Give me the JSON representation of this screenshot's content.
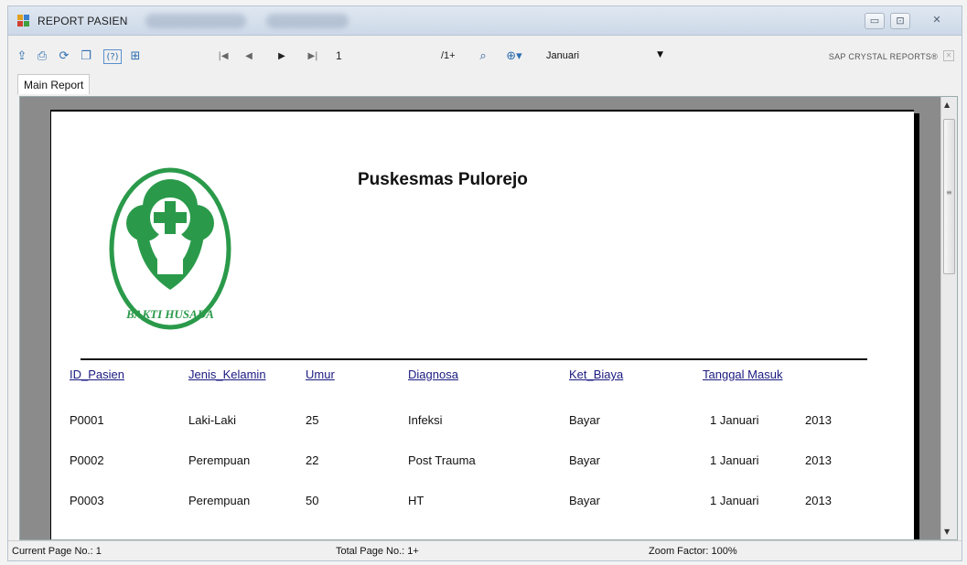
{
  "window": {
    "title": "REPORT PASIEN",
    "controls": {
      "minimize": "▭",
      "maximize": "⊡",
      "close": "✕"
    }
  },
  "toolbar": {
    "icons": [
      "export-icon",
      "print-icon",
      "refresh-icon",
      "copy-icon",
      "help-icon",
      "group-tree-icon",
      "first-page-icon",
      "prev-page-icon",
      "next-page-icon",
      "last-page-icon",
      "find-icon",
      "zoom-icon"
    ],
    "current_page": "1",
    "total_pages": "/1+",
    "zoom_value": "Januari",
    "brand": "SAP CRYSTAL REPORTS®"
  },
  "tab": {
    "label": "Main Report"
  },
  "report": {
    "title": "Puskesmas Pulorejo",
    "logo_text": "BAKTI HUSADA",
    "logo_color": "#2a9a4a",
    "columns": [
      "ID_Pasien",
      "Jenis_Kelamin",
      "Umur",
      "Diagnosa",
      "Ket_Biaya",
      "Tanggal Masuk"
    ],
    "rows": [
      {
        "id": "P0001",
        "jk": "Laki-Laki",
        "umur": "25",
        "diagnosa": "Infeksi",
        "biaya": "Bayar",
        "tanggal": "1 Januari",
        "tahun": "2013"
      },
      {
        "id": "P0002",
        "jk": "Perempuan",
        "umur": "22",
        "diagnosa": "Post Trauma",
        "biaya": "Bayar",
        "tanggal": "1 Januari",
        "tahun": "2013"
      },
      {
        "id": "P0003",
        "jk": "Perempuan",
        "umur": "50",
        "diagnosa": "HT",
        "biaya": "Bayar",
        "tanggal": "1 Januari",
        "tahun": "2013"
      }
    ]
  },
  "status": {
    "current_page": "Current Page No.: 1",
    "total_page": "Total Page No.: 1+",
    "zoom": "Zoom Factor: 100%"
  }
}
